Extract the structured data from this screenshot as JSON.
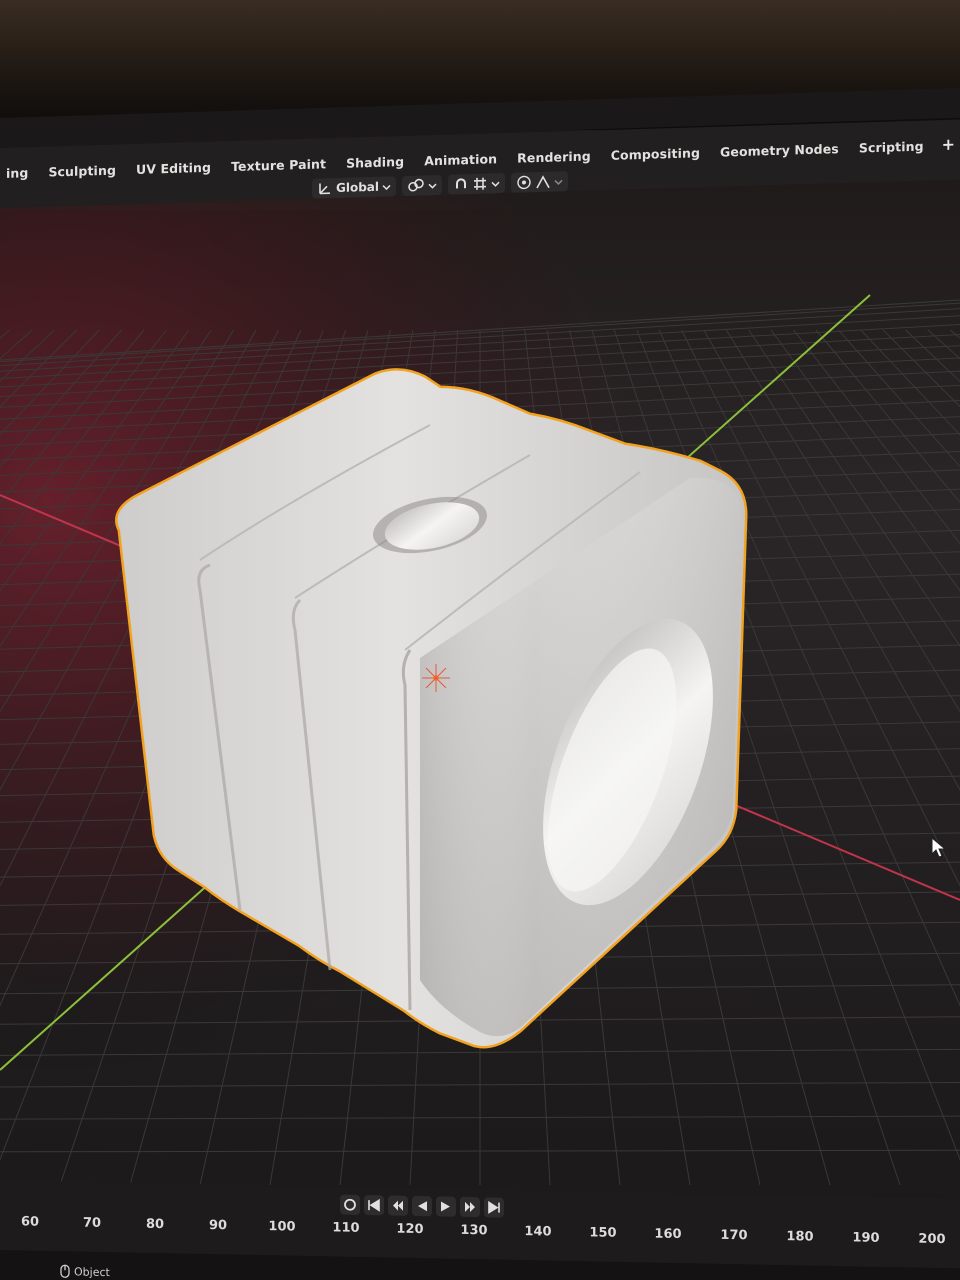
{
  "workspace_tabs": [
    {
      "label": "ing"
    },
    {
      "label": "Sculpting"
    },
    {
      "label": "UV Editing"
    },
    {
      "label": "Texture Paint"
    },
    {
      "label": "Shading"
    },
    {
      "label": "Animation"
    },
    {
      "label": "Rendering"
    },
    {
      "label": "Compositing"
    },
    {
      "label": "Geometry Nodes"
    },
    {
      "label": "Scripting"
    }
  ],
  "add_workspace_label": "+",
  "header": {
    "transform_orientation": "Global"
  },
  "timeline": {
    "frame_numbers": [
      "60",
      "70",
      "80",
      "90",
      "100",
      "110",
      "120",
      "130",
      "140",
      "150",
      "160",
      "170",
      "180",
      "190",
      "200"
    ]
  },
  "status": {
    "mode_label": "Object"
  },
  "colors": {
    "selection_outline": "#f2a21f",
    "x_axis": "#c2334c",
    "y_axis": "#8bc13a",
    "object_surface": "#d8d6d4",
    "grid_line": "#3b3838"
  }
}
